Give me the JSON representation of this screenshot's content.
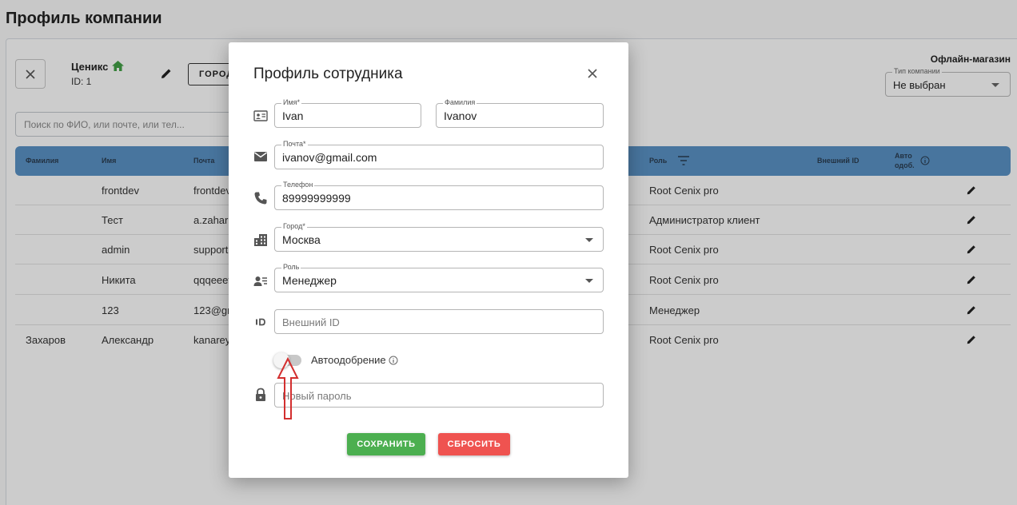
{
  "page": {
    "title": "Профиль компании",
    "company": {
      "name": "Ценикс",
      "id": "ID: 1"
    },
    "city_button": "ГОРОД",
    "store_type": "Офлайн-магазин",
    "company_type": {
      "legend": "Тип компании",
      "value": "Не выбран"
    },
    "search_placeholder": "Поиск по ФИО, или почте, или тел...",
    "table": {
      "headers": {
        "lastname": "Фамилия",
        "firstname": "Имя",
        "email": "Почта",
        "role": "Роль",
        "external_id": "Внешний ID",
        "auto_line1": "Авто",
        "auto_line2": "одоб."
      },
      "rows": [
        {
          "lastname": "",
          "firstname": "frontdev",
          "email": "frontdev",
          "role": "Root Cenix pro"
        },
        {
          "lastname": "",
          "firstname": "Тест",
          "email": "a.zahar",
          "role": "Администратор клиент"
        },
        {
          "lastname": "",
          "firstname": "admin",
          "email": "support",
          "role": "Root Cenix pro"
        },
        {
          "lastname": "",
          "firstname": "Никита",
          "email": "qqqeeet",
          "role": "Root Cenix pro"
        },
        {
          "lastname": "",
          "firstname": "123",
          "email": "123@gr",
          "role": "Менеджер"
        },
        {
          "lastname": "Захаров",
          "firstname": "Александр",
          "email": "kanarey",
          "role": "Root Cenix pro"
        }
      ]
    }
  },
  "dialog": {
    "title": "Профиль сотрудника",
    "fields": {
      "first_name": {
        "legend": "Имя*",
        "value": "Ivan"
      },
      "last_name": {
        "legend": "Фамилия",
        "value": "Ivanov"
      },
      "email": {
        "legend": "Почта*",
        "value": "ivanov@gmail.com"
      },
      "phone": {
        "legend": "Телефон",
        "value": "89999999999"
      },
      "city": {
        "legend": "Город*",
        "value": "Москва"
      },
      "role": {
        "legend": "Роль",
        "value": "Менеджер"
      },
      "external_id": {
        "placeholder": "Внешний ID"
      },
      "password": {
        "placeholder": "Новый пароль"
      }
    },
    "auto_approve": {
      "label": "Автоодобрение",
      "enabled": false
    },
    "buttons": {
      "save": "СОХРАНИТЬ",
      "reset": "СБРОСИТЬ"
    }
  },
  "colors": {
    "header": "#5b93c6",
    "save": "#4caf50",
    "reset": "#ef5350",
    "home": "#43a047",
    "annotation": "#d32f2f"
  },
  "icons": [
    "close-icon",
    "home-icon",
    "pencil-icon",
    "filter-icon",
    "info-icon",
    "id-card-icon",
    "mail-icon",
    "phone-icon",
    "city-icon",
    "role-icon",
    "id-icon",
    "lock-icon"
  ]
}
